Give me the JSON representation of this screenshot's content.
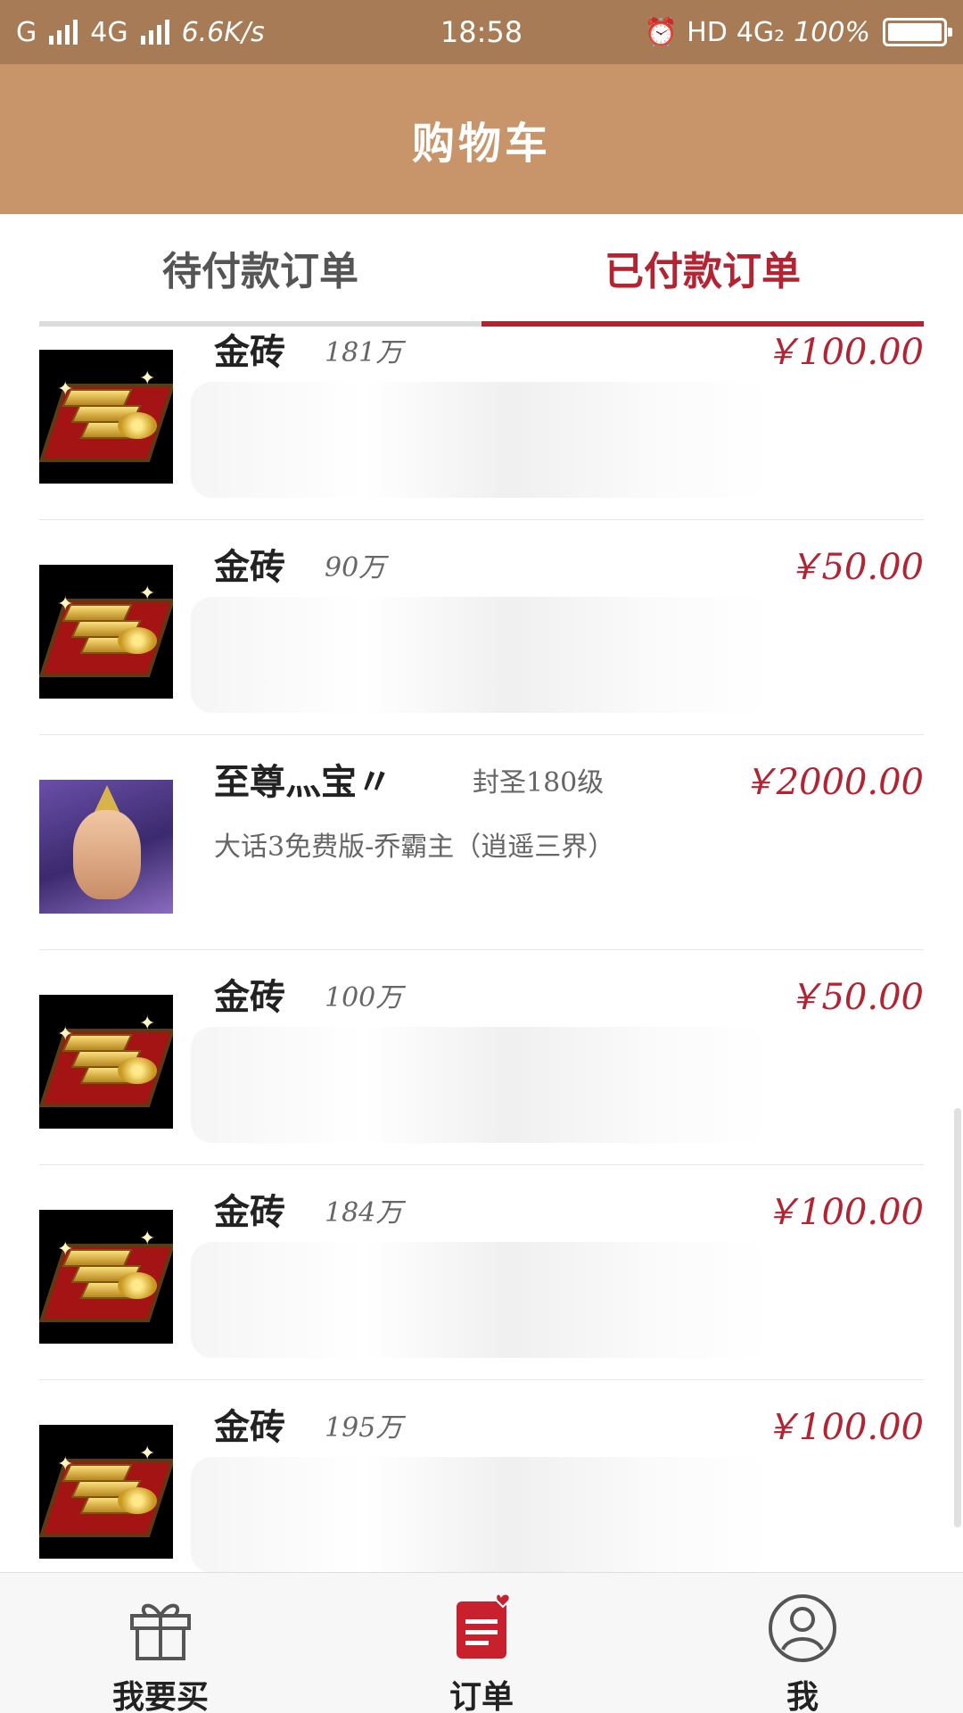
{
  "status_bar": {
    "carrier": "G",
    "network": "4G",
    "speed": "6.6K/s",
    "time": "18:58",
    "hd": "HD",
    "network_right": "4G₂",
    "battery": "100%"
  },
  "header": {
    "title": "购物车"
  },
  "tabs": [
    {
      "label": "待付款订单",
      "active": false
    },
    {
      "label": "已付款订单",
      "active": true
    }
  ],
  "orders": [
    {
      "name": "金砖",
      "amount": "181万",
      "price": "￥100.00",
      "icon": "gold-bricks-icon"
    },
    {
      "name": "金砖",
      "amount": "90万",
      "price": "￥50.00",
      "icon": "gold-bricks-icon"
    },
    {
      "name": "至尊灬宝〃",
      "level": "封圣180级",
      "server": "大话3免费版-乔霸主（逍遥三界）",
      "price": "￥2000.00",
      "icon": "hero-avatar-icon"
    },
    {
      "name": "金砖",
      "amount": "100万",
      "price": "￥50.00",
      "icon": "gold-bricks-icon"
    },
    {
      "name": "金砖",
      "amount": "184万",
      "price": "￥100.00",
      "icon": "gold-bricks-icon"
    },
    {
      "name": "金砖",
      "amount": "195万",
      "price": "￥100.00",
      "icon": "gold-bricks-icon"
    }
  ],
  "bottom_nav": [
    {
      "label": "我要买",
      "icon": "gift-icon",
      "active": false
    },
    {
      "label": "订单",
      "icon": "order-list-icon",
      "active": true
    },
    {
      "label": "我",
      "icon": "user-icon",
      "active": false
    }
  ],
  "colors": {
    "status_bar": "#a77b55",
    "header": "#c8956a",
    "accent": "#b32331"
  }
}
